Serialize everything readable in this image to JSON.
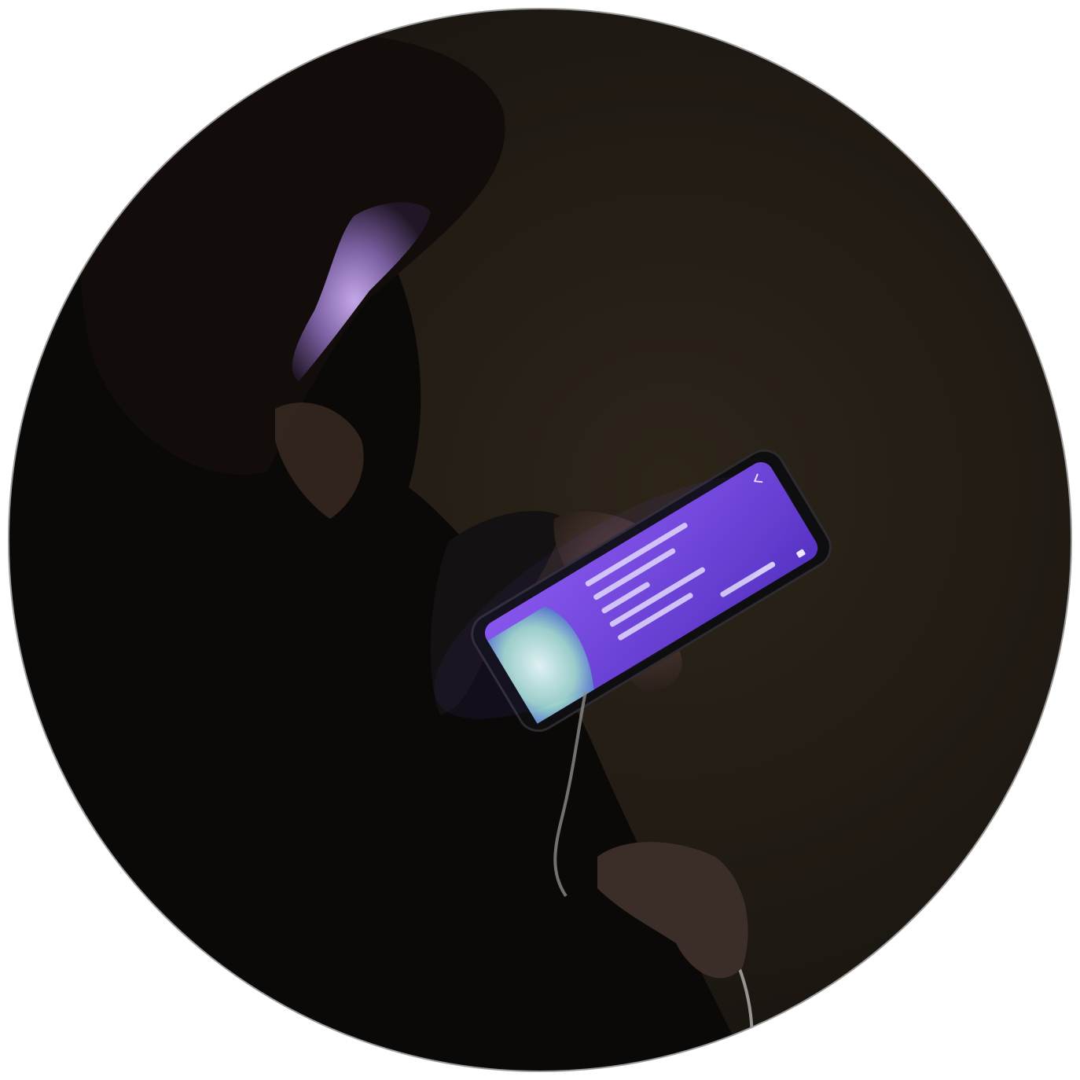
{
  "photo": {
    "colors": {
      "page_background": "#ffffff",
      "circle_outline": "#9a9a9a",
      "room_dark": "#1b1610",
      "room_mid": "#2a2319",
      "figure": "#0b0908",
      "hair": "#120d0b",
      "face_glow": "#b89ad8",
      "hand": "#4a3a33",
      "phone_body": "#0e0e10",
      "screen_top": "#7c4ee6",
      "screen_bottom": "#5d36c9",
      "screen_image": "#b8e6d6",
      "screen_text": "#ece6ff",
      "cable": "#8c8c8c"
    },
    "icons": [
      "back-arrow-icon",
      "audio-icon"
    ]
  }
}
